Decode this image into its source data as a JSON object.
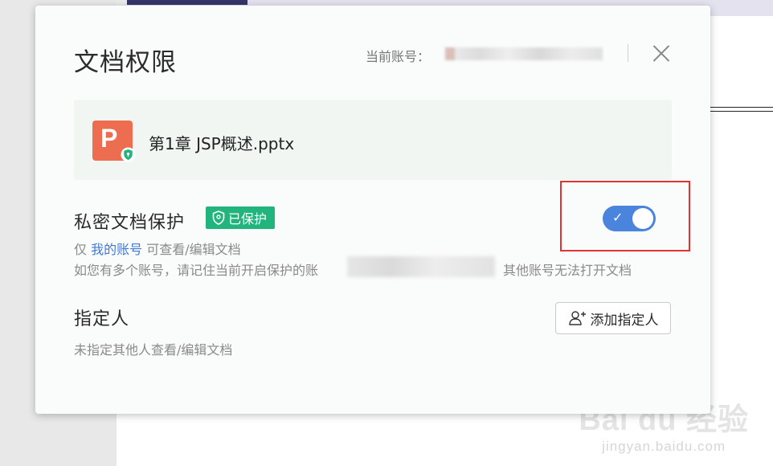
{
  "dialog": {
    "title": "文档权限",
    "account_label": "当前账号："
  },
  "file": {
    "icon_letter": "P",
    "name": "第1章 JSP概述.pptx"
  },
  "privacy": {
    "title": "私密文档保护",
    "badge": "已保护",
    "desc_prefix": "仅 ",
    "desc_link": "我的账号",
    "desc_suffix": " 可查看/编辑文档",
    "desc2_head": "如您有多个账号，请记住当前开启保护的账",
    "desc2_tail": "其他账号无法打开文档",
    "toggle_on": true,
    "toggle_check": "✓"
  },
  "assignee": {
    "title": "指定人",
    "desc": "未指定其他人查看/编辑文档",
    "add_button": "添加指定人"
  },
  "watermark": {
    "main": "Bai du 经验",
    "sub": "jingyan.baidu.com"
  },
  "colors": {
    "accent": "#4b84dd",
    "badge_green": "#21b57d",
    "highlight_red": "#e03434",
    "pptx_orange": "#ec6d4f"
  }
}
